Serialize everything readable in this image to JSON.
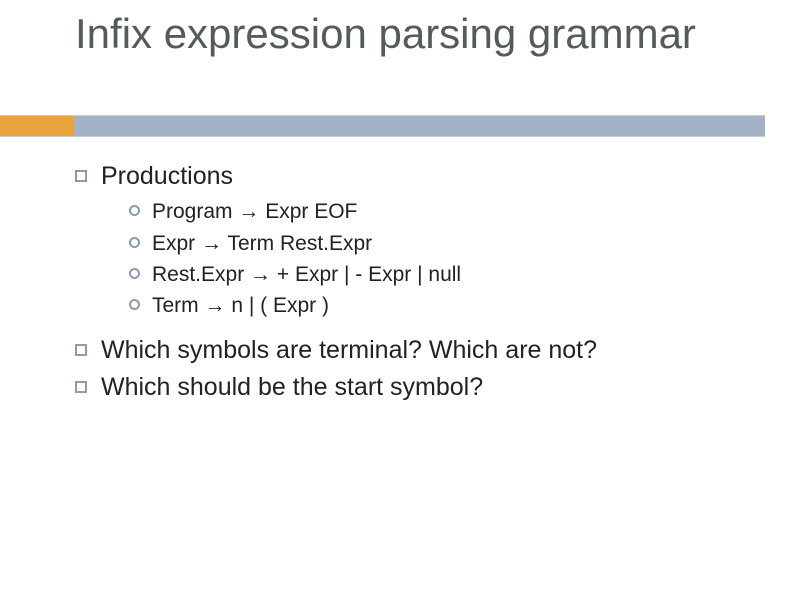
{
  "title": "Infix expression parsing grammar",
  "bullets": [
    {
      "text": "Productions",
      "sub": [
        "Program → Expr EOF",
        "Expr → Term Rest.Expr",
        "Rest.Expr → + Expr | - Expr | null",
        "Term → n | ( Expr )"
      ]
    },
    {
      "text": "Which symbols are terminal?  Which are not?"
    },
    {
      "text": "Which should be the start symbol?"
    }
  ],
  "colors": {
    "accent_orange": "#e8a33d",
    "accent_gray_blue": "#a3b2c7",
    "bullet_border": "#8a9bb3",
    "title_text": "#555a5a"
  }
}
